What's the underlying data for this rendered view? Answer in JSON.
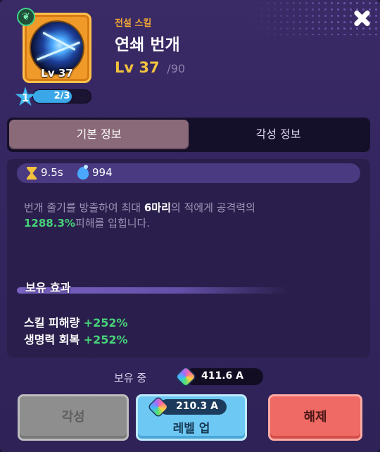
{
  "header": {
    "grade": "전설 스킬",
    "skill_name": "연쇄 번개",
    "level_current": "Lv 37",
    "level_max": "/90",
    "icon_level": "Lv 37"
  },
  "awaken": {
    "stars": "1",
    "progress_text": "2/3",
    "progress_fraction": 0.667
  },
  "tabs": [
    {
      "label": "기본 정보",
      "active": true
    },
    {
      "label": "각성 정보",
      "active": false
    }
  ],
  "stats": {
    "cooldown": "9.5s",
    "mana_cost": "994"
  },
  "description": {
    "part1": "번개 줄기를 방출하여 최대 ",
    "highlight": "6마리",
    "part2": "의 적에게 공격력의",
    "percent": "1288.3%",
    "part3": "피해를 입힙니다."
  },
  "effects": {
    "title": "보유 효과",
    "items": [
      {
        "label": "스킬 피해량 ",
        "value": "+252%"
      },
      {
        "label": "생명력 회복 ",
        "value": "+252%"
      }
    ]
  },
  "currency": {
    "owned_label": "보유 중",
    "owned_value": "411.6 A",
    "levelup_cost": "210.3 A"
  },
  "buttons": {
    "awaken": "각성",
    "levelup": "레벨 업",
    "release": "해제"
  },
  "colors": {
    "accent_gold": "#f4c33e",
    "grade_orange": "#f2a734",
    "highlight_green": "#47d27a",
    "levelup_blue": "#6ec8f4",
    "release_red": "#ef6a64"
  },
  "icons": [
    "close-icon",
    "leaf-icon",
    "hourglass-icon",
    "mana-icon",
    "gem-icon"
  ]
}
